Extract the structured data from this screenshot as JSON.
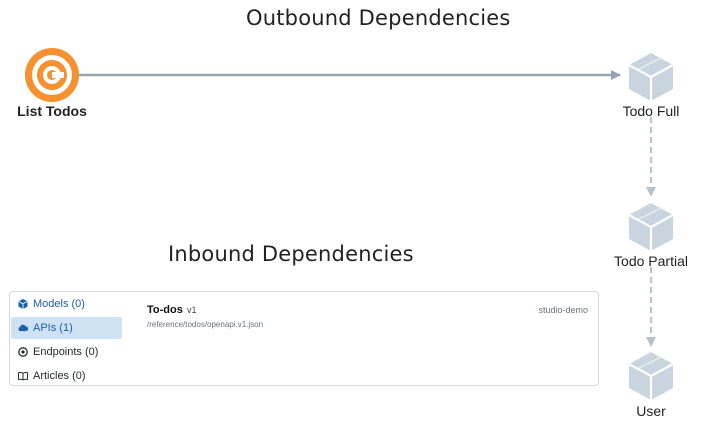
{
  "outbound": {
    "title": "Outbound Dependencies",
    "nodes": [
      {
        "label": "List Todos",
        "icon": "operation-target-icon"
      },
      {
        "label": "Todo Full",
        "icon": "model-cube-icon"
      },
      {
        "label": "Todo Partial",
        "icon": "model-cube-icon"
      },
      {
        "label": "User",
        "icon": "model-cube-icon"
      }
    ],
    "colors": {
      "source": "#f7902e",
      "model": "#c9d5de",
      "edge": "#97a5b0"
    }
  },
  "inbound": {
    "title": "Inbound Dependencies",
    "sidebar": [
      {
        "label": "Models (0)",
        "icon": "cube-icon"
      },
      {
        "label": "APIs (1)",
        "icon": "cloud-icon"
      },
      {
        "label": "Endpoints (0)",
        "icon": "target-icon"
      },
      {
        "label": "Articles (0)",
        "icon": "book-icon"
      }
    ],
    "selected": "APIs (1)",
    "api": {
      "name": "To-dos",
      "version": "v1",
      "path": "/reference/todos/openapi.v1.json",
      "project": "studio-demo"
    }
  }
}
